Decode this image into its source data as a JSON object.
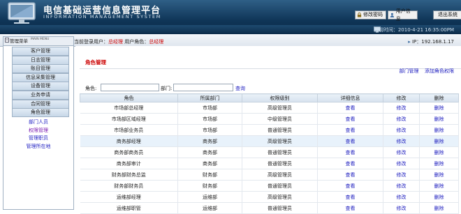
{
  "header": {
    "title": "电信基础运营信息管理平台",
    "subtitle": "INFORMATION MANAGEMENT SYSTEM",
    "buttons": {
      "change_password": "修改密码",
      "user_info": "用户信息",
      "exit": "退出系统"
    },
    "time_label": "当前时间：2010-4-21 16:35:00PM"
  },
  "statusbar": {
    "menu_title": "管理菜单",
    "menu_subtitle": "MAIN MENU",
    "user_prefix": "当前登录用户：",
    "user_name": "总经理",
    "role_prefix": " 用户角色：",
    "role_name": "总经理",
    "ip_label": "IP：192.168.1.17"
  },
  "sidebar": {
    "items": [
      "客户管理",
      "日志管理",
      "账目管理",
      "信息采集管理",
      "设备管理",
      "业务申请",
      "合同管理",
      "角色管理"
    ],
    "subitems": [
      {
        "label": "部门人员",
        "active": false
      },
      {
        "label": "权限管理",
        "active": true
      },
      {
        "label": "管理职员",
        "active": false
      },
      {
        "label": "管理所在地",
        "active": false
      }
    ]
  },
  "main": {
    "page_title": "角色管理",
    "links": {
      "dept_manage": "部门管理",
      "add_role": "添加角色权限"
    },
    "filter": {
      "role_label": "角色:",
      "dept_label": "部门:",
      "search": "查询"
    },
    "columns": [
      "角色",
      "所属部门",
      "权限级别",
      "详细信息",
      "修改",
      "删除"
    ],
    "rows": [
      {
        "role": "市场部总经理",
        "dept": "市场部",
        "level": "高级管理员",
        "detail": "查看",
        "edit": "修改",
        "del": "删除"
      },
      {
        "role": "市场部区域经理",
        "dept": "市场部",
        "level": "中级管理员",
        "detail": "查看",
        "edit": "修改",
        "del": "删除"
      },
      {
        "role": "市场部业务员",
        "dept": "市场部",
        "level": "普通管理员",
        "detail": "查看",
        "edit": "修改",
        "del": "删除"
      },
      {
        "role": "商务部经理",
        "dept": "商务部",
        "level": "高级管理员",
        "detail": "查看",
        "edit": "修改",
        "del": "删除"
      },
      {
        "role": "商务部商务员",
        "dept": "商务部",
        "level": "普通管理员",
        "detail": "查看",
        "edit": "修改",
        "del": "删除"
      },
      {
        "role": "商务部审计",
        "dept": "商务部",
        "level": "普通管理员",
        "detail": "查看",
        "edit": "修改",
        "del": "删除"
      },
      {
        "role": "财务部财务总监",
        "dept": "财务部",
        "level": "高级管理员",
        "detail": "查看",
        "edit": "修改",
        "del": "删除"
      },
      {
        "role": "财务部财务员",
        "dept": "财务部",
        "level": "普通管理员",
        "detail": "查看",
        "edit": "修改",
        "del": "删除"
      },
      {
        "role": "运维部经理",
        "dept": "运维部",
        "level": "高级管理员",
        "detail": "查看",
        "edit": "修改",
        "del": "删除"
      },
      {
        "role": "运维部职管",
        "dept": "运维部",
        "level": "普通管理员",
        "detail": "查看",
        "edit": "修改",
        "del": "删除"
      }
    ]
  },
  "colors": {
    "accent_red": "#cc0000",
    "link_blue": "#2020c0",
    "header_dark": "#0f3557"
  }
}
